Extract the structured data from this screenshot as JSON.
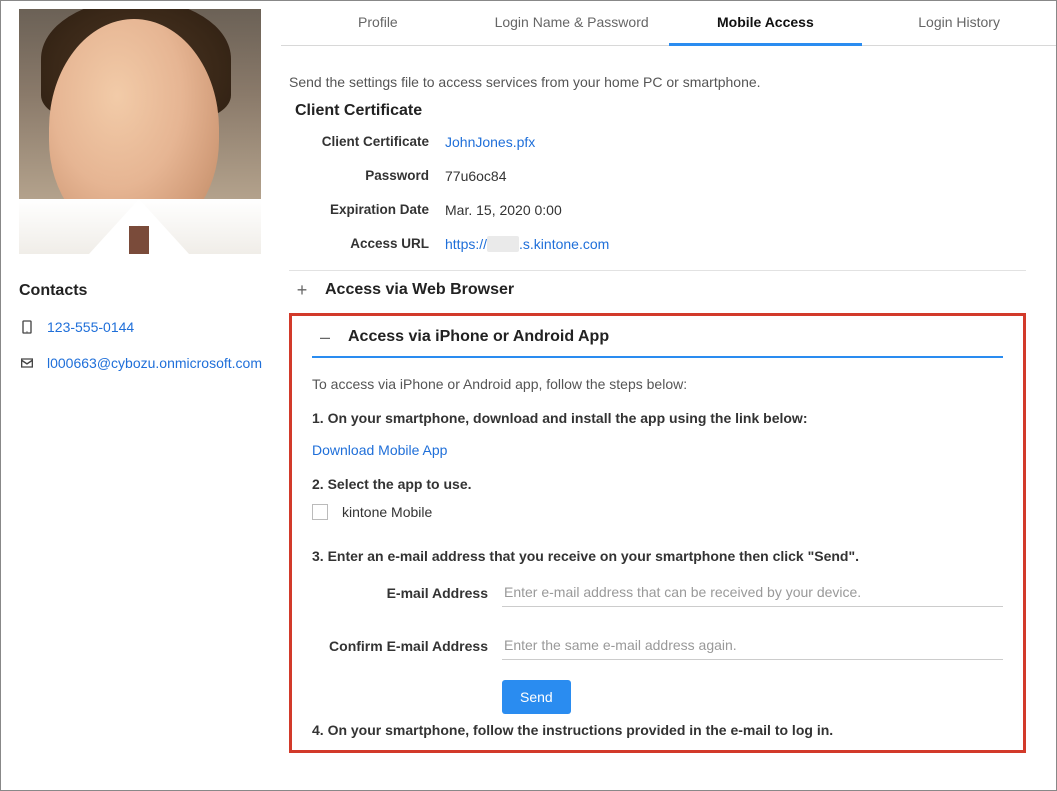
{
  "sidebar": {
    "contacts_title": "Contacts",
    "phone": "123-555-0144",
    "email": "l000663@cybozu.onmicrosoft.com"
  },
  "tabs": [
    {
      "label": "Profile",
      "active": false
    },
    {
      "label": "Login Name & Password",
      "active": false
    },
    {
      "label": "Mobile Access",
      "active": true
    },
    {
      "label": "Login History",
      "active": false
    }
  ],
  "intro": "Send the settings file to access services from your home PC or smartphone.",
  "cert": {
    "title": "Client Certificate",
    "rows": {
      "client_cert_label": "Client Certificate",
      "client_cert_value": "JohnJones.pfx",
      "password_label": "Password",
      "password_value": "77u6oc84",
      "exp_label": "Expiration Date",
      "exp_value": "Mar. 15, 2020 0:00",
      "url_label": "Access URL",
      "url_prefix": "https://",
      "url_visible": ".s.kintone.com"
    }
  },
  "accordion": {
    "web": {
      "icon": "+",
      "title": "Access via Web Browser"
    },
    "app": {
      "icon": "–",
      "title": "Access via iPhone or Android App",
      "intro": "To access via iPhone or Android app, follow the steps below:",
      "step1": "1. On your smartphone, download and install the app using the link below:",
      "download_link": "Download Mobile App",
      "step2": "2. Select the app to use.",
      "checkbox_label": "kintone Mobile",
      "step3": "3. Enter an e-mail address that you receive on your smartphone then click \"Send\".",
      "email_label": "E-mail Address",
      "email_placeholder": "Enter e-mail address that can be received by your device.",
      "confirm_label": "Confirm E-mail Address",
      "confirm_placeholder": "Enter the same e-mail address again.",
      "send_label": "Send",
      "step4": "4. On your smartphone, follow the instructions provided in the e-mail to log in."
    }
  }
}
